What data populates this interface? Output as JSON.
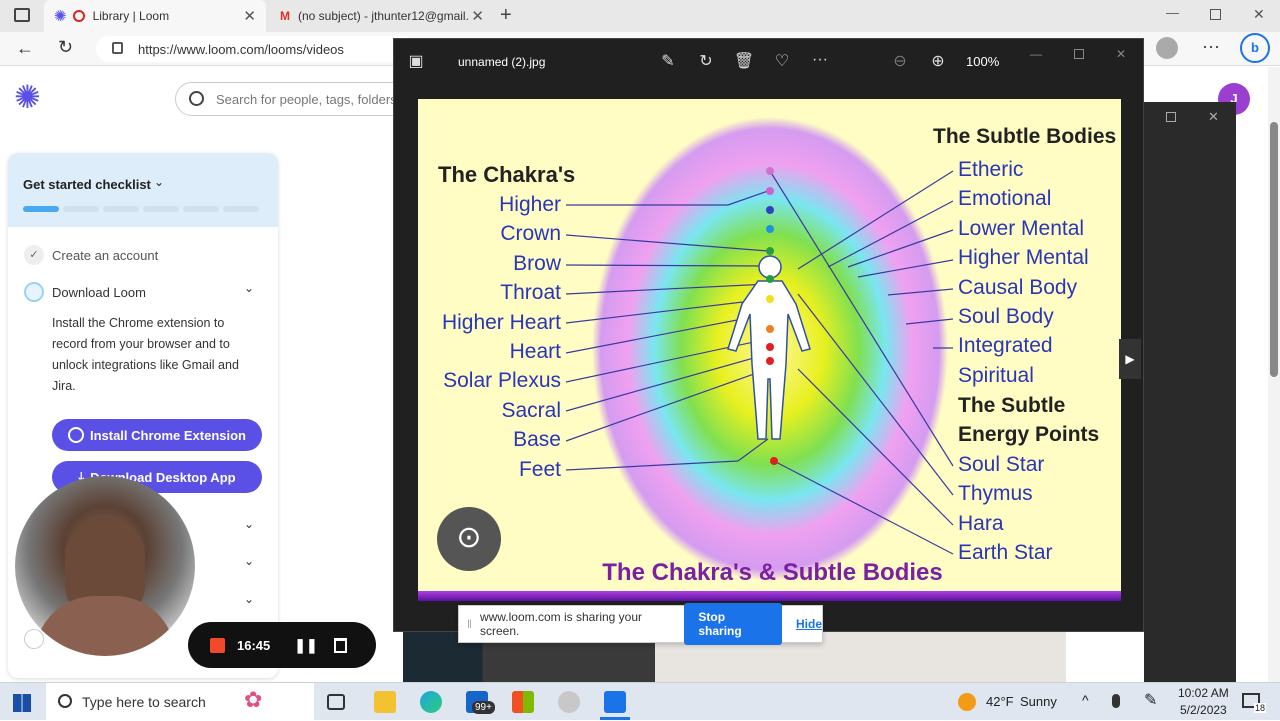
{
  "browser": {
    "tabs": [
      {
        "label": "Library | Loom",
        "active": true
      },
      {
        "label": "(no subject) - jthunter12@gmail.",
        "active": false
      }
    ],
    "url": "https://www.loom.com/looms/videos"
  },
  "loom": {
    "search_placeholder": "Search for people, tags, folders",
    "avatar_letter": "J",
    "checklist": {
      "title": "Get started checklist",
      "items": [
        {
          "label": "Create an account",
          "done": true
        },
        {
          "label": "Download Loom",
          "done": false
        }
      ],
      "download_desc": "Install the Chrome extension to record from your browser and to unlock integrations like Gmail and Jira.",
      "install_button": "Install Chrome Extension",
      "desktop_button": "Download Desktop App"
    }
  },
  "viewer": {
    "filename": "unnamed (2).jpg",
    "zoom": "100%"
  },
  "image": {
    "left_title": "The Chakra's",
    "chakras": [
      "Higher",
      "Crown",
      "Brow",
      "Throat",
      "Higher Heart",
      "Heart",
      "Solar Plexus",
      "Sacral",
      "Base",
      "Feet"
    ],
    "right_title": "The Subtle Bodies",
    "bodies": [
      "Etheric",
      "Emotional",
      "Lower Mental",
      "Higher Mental",
      "Causal Body",
      "Soul Body",
      "Integrated",
      "Spiritual"
    ],
    "energy_title_1": "The Subtle",
    "energy_title_2": "Energy Points",
    "points": [
      "Soul Star",
      "Thymus",
      "Hara",
      "Earth Star"
    ],
    "bottom_title": "The Chakra's & Subtle Bodies",
    "chakra_colors": [
      "#d070d0",
      "#d060d0",
      "#3040c0",
      "#2090e0",
      "#20a040",
      "#20a040",
      "#f0e020",
      "#f08020",
      "#e02020",
      "#e02020"
    ]
  },
  "share_bar": {
    "message": "www.loom.com is sharing your screen.",
    "stop": "Stop sharing",
    "hide": "Hide"
  },
  "recorder": {
    "time": "16:45"
  },
  "taskbar": {
    "search_placeholder": "Type here to search",
    "weather_temp": "42°F",
    "weather_desc": "Sunny",
    "time": "10:02 AM",
    "date": "5/2/2023",
    "mail_badge": "99+",
    "notif_count": "18"
  }
}
